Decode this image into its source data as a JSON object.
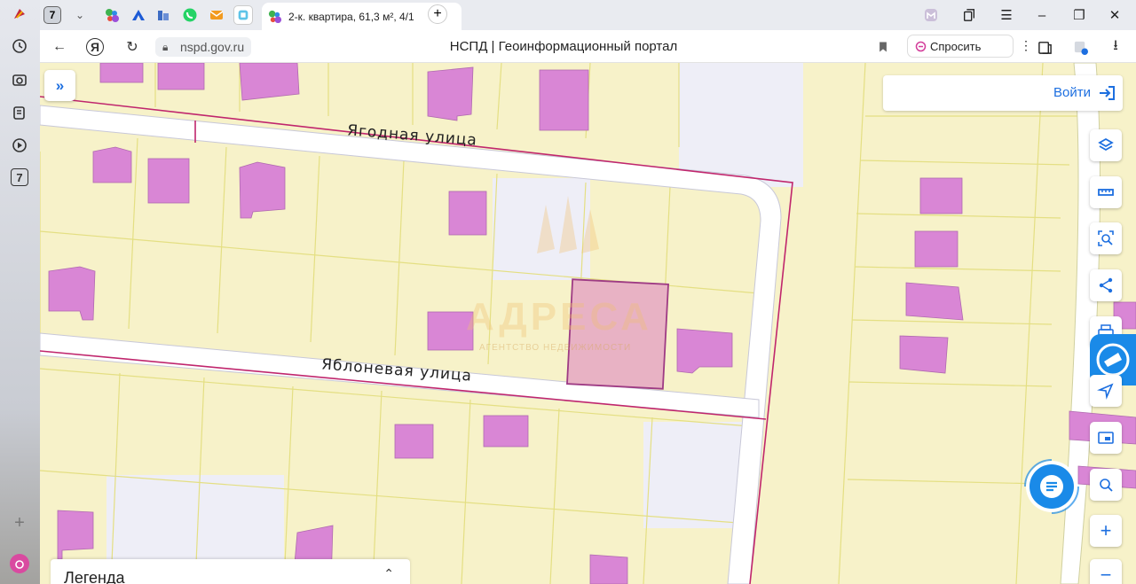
{
  "browser": {
    "tab_badge": "7",
    "active_tab_title": "2-к. квартира, 61,3 м², 4/1",
    "url": "nspd.gov.ru",
    "page_title": "НСПД | Геоинформационный портал",
    "ask_label": "Спросить",
    "sidebar_badge": "7"
  },
  "map": {
    "streets": [
      {
        "name": "Ягодная  улица"
      },
      {
        "name": "Яблоневая  улица"
      }
    ],
    "watermark": "АДРЕСА",
    "watermark_sub": "АГЕНТСТВО НЕДВИЖИМОСТИ"
  },
  "panel": {
    "login_label": "Войти",
    "legend_label": "Легенда"
  },
  "tools": [
    {
      "icon": "layers-icon"
    },
    {
      "icon": "ruler-icon"
    },
    {
      "icon": "area-search-icon"
    },
    {
      "icon": "share-icon"
    },
    {
      "icon": "print-icon"
    },
    {
      "icon": "navigate-icon"
    },
    {
      "icon": "picture-in-picture-icon"
    },
    {
      "icon": "location-search-icon"
    },
    {
      "icon": "zoom-in-icon"
    },
    {
      "icon": "zoom-out-icon"
    }
  ],
  "colors": {
    "parcel_fill": "#f7f2c9",
    "parcel_line": "#e4df83",
    "building": "#d986d5",
    "boundary": "#c0266d",
    "road": "#ffffff",
    "accent": "#1d6fe0"
  }
}
